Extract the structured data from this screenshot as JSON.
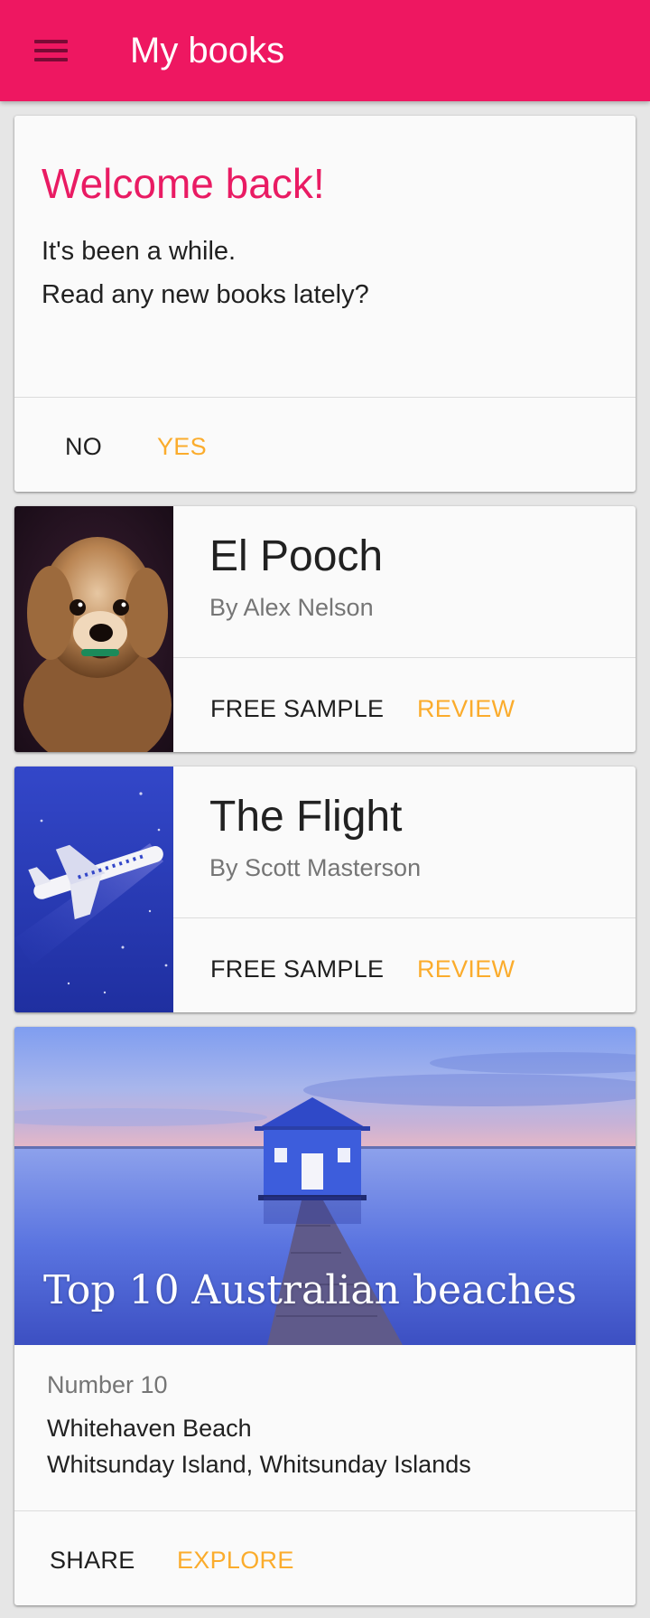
{
  "app_bar": {
    "title": "My books",
    "menu_icon": "hamburger-menu-icon",
    "color": "#ee1761"
  },
  "welcome_card": {
    "heading": "Welcome back!",
    "lines": [
      "It's been a while.",
      "Read any new books lately?"
    ],
    "actions": {
      "no": "NO",
      "yes": "YES"
    }
  },
  "books": [
    {
      "title": "El Pooch",
      "author": "By Alex Nelson",
      "cover": "dog-photo",
      "actions": {
        "sample": "FREE SAMPLE",
        "review": "REVIEW"
      }
    },
    {
      "title": "The Flight",
      "author": "By Scott Masterson",
      "cover": "airplane-illustration",
      "actions": {
        "sample": "FREE SAMPLE",
        "review": "REVIEW"
      }
    }
  ],
  "feature_card": {
    "title": "Top 10 Australian beaches",
    "image": "boathouse-on-lake-photo",
    "number": "Number 10",
    "place": "Whitehaven Beach",
    "region": "Whitsunday Island, Whitsunday Islands",
    "actions": {
      "share": "SHARE",
      "explore": "EXPLORE"
    }
  },
  "colors": {
    "primary": "#ee1761",
    "accent": "#fbac2c",
    "heading": "#e91b63"
  }
}
